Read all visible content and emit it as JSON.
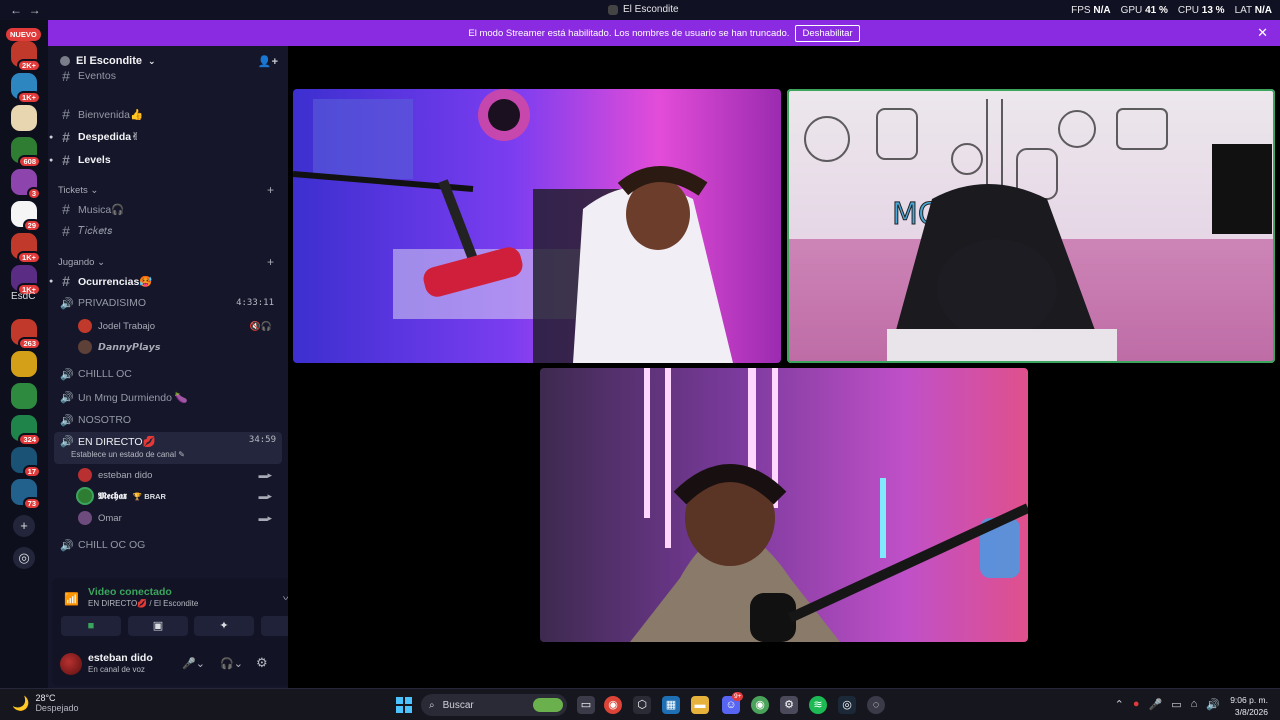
{
  "window": {
    "title": "El Escondite",
    "stats": [
      {
        "label": "FPS",
        "value": "N/A"
      },
      {
        "label": "GPU",
        "value": "41 %"
      },
      {
        "label": "CPU",
        "value": "13 %"
      },
      {
        "label": "LAT",
        "value": "N/A"
      }
    ]
  },
  "banner": {
    "text": "El modo Streamer está habilitado. Los nombres de usuario se han truncado.",
    "button": "Deshabilitar"
  },
  "rail": {
    "new_badge": "NUEVO",
    "guilds": [
      {
        "badge": "2K+",
        "color": "#c0392b"
      },
      {
        "badge": "1K+",
        "color": "#2e86c1"
      },
      {
        "badge": "",
        "color": "#e8d6b0"
      },
      {
        "badge": "608",
        "color": "#2f7d32"
      },
      {
        "badge": "3",
        "color": "#8e44ad"
      },
      {
        "badge": "29",
        "color": "#f5f5f5"
      },
      {
        "badge": "1K+",
        "color": "#c0392b"
      },
      {
        "badge": "1K+",
        "color": "#5b2c83"
      }
    ],
    "text_guild": "EsdC",
    "guilds2": [
      {
        "badge": "263",
        "color": "#c0392b"
      },
      {
        "badge": "",
        "color": "#d4a017"
      },
      {
        "badge": "",
        "color": "#2d8a3e"
      },
      {
        "badge": "324",
        "color": "#1e8449"
      },
      {
        "badge": "17",
        "color": "#1a5276"
      },
      {
        "badge": "73",
        "color": "#21618c"
      }
    ]
  },
  "sidebar": {
    "server_name": "El Escondite",
    "partial_channel": "Eventos",
    "channels_top": [
      {
        "name": "Bienvenida👍",
        "unread": false
      },
      {
        "name": "Despedida✌",
        "unread": true
      },
      {
        "name": "Levels",
        "unread": true
      }
    ],
    "category_tickets": "Tickets",
    "tickets_channels": [
      {
        "name": "Musica🎧"
      },
      {
        "name": "𝑇𝑖𝑐𝑘𝑒𝑡𝑠"
      }
    ],
    "category_jugando": "Jugando",
    "jugando_channel": "Ocurrencias🥵",
    "voice_privadisimo": {
      "name": "PRIVADISIMO",
      "timer": "4:33:11"
    },
    "privadisimo_members": [
      {
        "name": "Jodel Trabajo"
      },
      {
        "name": "𝘿𝙖𝙣𝙣𝙮𝙋𝙡𝙖𝙮𝙨"
      }
    ],
    "voice_channels": [
      {
        "name": "CHILLL OC"
      },
      {
        "name": "Un Mmg Durmiendo 🍆"
      },
      {
        "name": "NOSOTRO"
      }
    ],
    "voice_live": {
      "name": "EN DIRECTO💋",
      "timer": "34:59",
      "status": "Establece un estado de canal ✎"
    },
    "live_members": [
      {
        "name": "esteban dido",
        "tag": ""
      },
      {
        "name": "𝕸𝖊𝖈𝖍𝖆𝖝",
        "tag": "🏆 BRAR"
      },
      {
        "name": "Omar",
        "tag": ""
      }
    ],
    "voice_last": {
      "name": "CHILL OC OG"
    }
  },
  "voice_panel": {
    "title": "Video conectado",
    "subtitle": "EN DIRECTO💋 / El Escondite"
  },
  "user_panel": {
    "name": "esteban dido",
    "status": "En canal de voz"
  },
  "taskbar": {
    "temperature": "28°C",
    "weather": "Despejado",
    "search_placeholder": "Buscar",
    "time": "9:06 p. m.",
    "date": "3/8/2026",
    "discord_badge": "9+"
  }
}
